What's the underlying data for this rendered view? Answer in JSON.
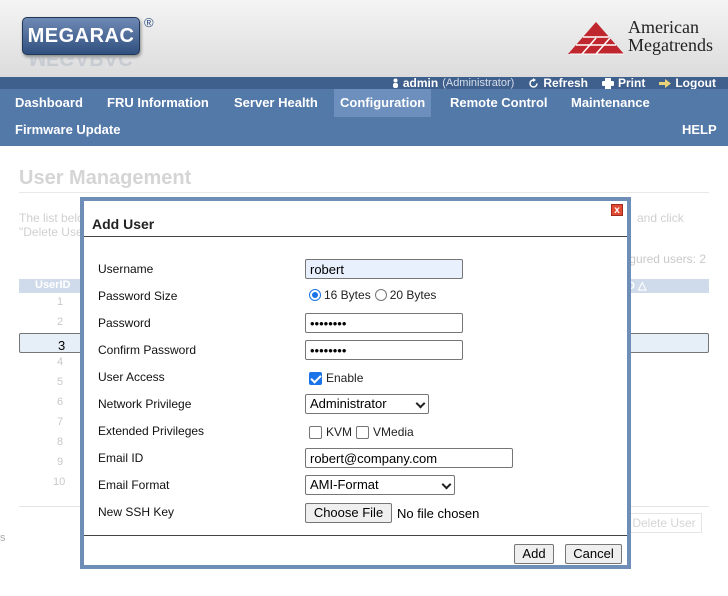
{
  "header": {
    "logo_text": "MEGARAC",
    "logo_reg": "®",
    "brand_line1": "American",
    "brand_line2": "Megatrends"
  },
  "userbar": {
    "user": "admin",
    "role": "(Administrator)",
    "refresh": "Refresh",
    "print": "Print",
    "logout": "Logout"
  },
  "nav": {
    "items": [
      "Dashboard",
      "FRU Information",
      "Server Health",
      "Configuration",
      "Remote Control",
      "Maintenance",
      "Firmware Update",
      "HELP"
    ],
    "active": "Configuration"
  },
  "page": {
    "title": "User Management",
    "desc_left_1": "The list belo",
    "desc_left_2": "\"Delete Use",
    "desc_right": "and click",
    "configured": "gured users: 2",
    "col_userid": "UserID",
    "col_right": "D △",
    "rows": [
      "1",
      "2",
      "3",
      "4",
      "5",
      "6",
      "7",
      "8",
      "9",
      "10"
    ],
    "delete_button": "Delete User",
    "left_char": "s"
  },
  "dialog": {
    "title": "Add User",
    "close_glyph": "x",
    "username_label": "Username",
    "username_value": "robert",
    "password_size_label": "Password Size",
    "size_16": "16 Bytes",
    "size_20": "20 Bytes",
    "password_label": "Password",
    "password_value": "••••••••",
    "confirm_label": "Confirm Password",
    "confirm_value": "••••••••",
    "access_label": "User Access",
    "access_enable": "Enable",
    "network_label": "Network Privilege",
    "network_value": "Administrator",
    "extended_label": "Extended Privileges",
    "kvm": "KVM",
    "vmedia": "VMedia",
    "email_label": "Email ID",
    "email_value": "robert@company.com",
    "format_label": "Email Format",
    "format_value": "AMI-Format",
    "ssh_label": "New SSH Key",
    "choose_file": "Choose File",
    "no_file": "No file chosen",
    "add_button": "Add",
    "cancel_button": "Cancel"
  },
  "colors": {
    "nav_bg": "#5379a9",
    "topbar_bg": "#3f5f8c",
    "dialog_border": "#6e8eb8",
    "brand_red": "#c0262d"
  }
}
